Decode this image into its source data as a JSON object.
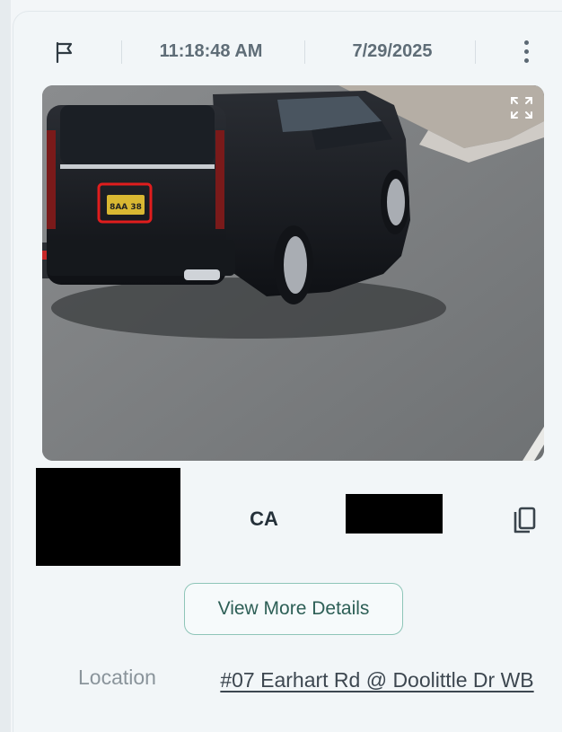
{
  "header": {
    "time": "11:18:48 AM",
    "date": "7/29/2025"
  },
  "vehicle": {
    "state": "CA",
    "plate_text": "8AA 38"
  },
  "actions": {
    "details_label": "View More Details"
  },
  "location": {
    "label": "Location",
    "value": "#07 Earhart Rd @ Doolittle Dr WB"
  },
  "icons": {
    "flag": "flag-icon",
    "menu": "kebab-menu-icon",
    "expand": "expand-icon",
    "copy": "copy-icon"
  },
  "colors": {
    "accent_border": "#8ec5b8",
    "accent_text": "#2d5f56",
    "plate_highlight": "#e01d1d"
  }
}
